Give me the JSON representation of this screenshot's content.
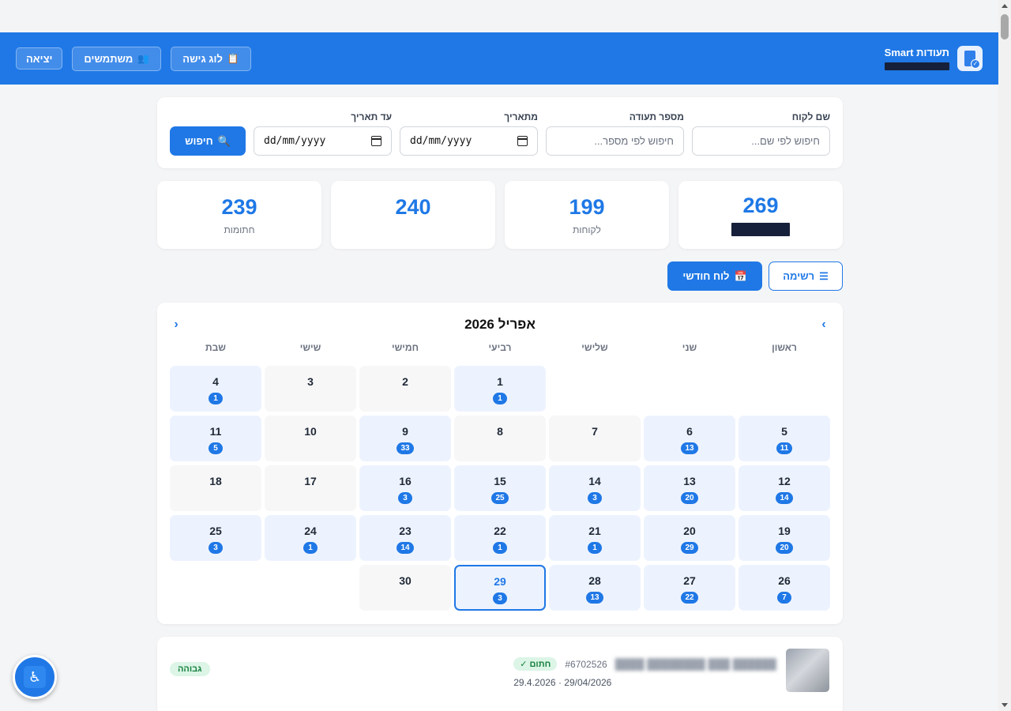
{
  "header": {
    "brand_title": "תעודות Smart",
    "buttons": {
      "access_log": "לוג גישה",
      "users": "משתמשים",
      "logout": "יציאה"
    },
    "icons": {
      "access_log": "clipboard-icon",
      "users": "users-icon"
    }
  },
  "search": {
    "customer_label": "שם לקוח",
    "customer_placeholder": "חיפוש לפי שם...",
    "doc_label": "מספר תעודה",
    "doc_placeholder": "חיפוש לפי מספר...",
    "from_label": "מתאריך",
    "from_value": "dd/mm/yyyy",
    "to_label": "עד תאריך",
    "to_value": "dd/mm/yyyy",
    "search_button": "חיפוש"
  },
  "stats": [
    {
      "value": "269",
      "label": ""
    },
    {
      "value": "199",
      "label": "לקוחות"
    },
    {
      "value": "240",
      "label": ""
    },
    {
      "value": "239",
      "label": "חתומות"
    }
  ],
  "view": {
    "list": "רשימה",
    "month": "לוח חודשי"
  },
  "calendar": {
    "title": "אפריל 2026",
    "weekdays": [
      "ראשון",
      "שני",
      "שלישי",
      "רביעי",
      "חמישי",
      "שישי",
      "שבת"
    ],
    "today": 29,
    "weeks": [
      [
        null,
        null,
        null,
        {
          "d": 1,
          "c": 1
        },
        {
          "d": 2,
          "c": 0
        },
        {
          "d": 3,
          "c": 0
        },
        {
          "d": 4,
          "c": 1
        }
      ],
      [
        {
          "d": 5,
          "c": 11
        },
        {
          "d": 6,
          "c": 13
        },
        {
          "d": 7,
          "c": 0
        },
        {
          "d": 8,
          "c": 0
        },
        {
          "d": 9,
          "c": 33
        },
        {
          "d": 10,
          "c": 0
        },
        {
          "d": 11,
          "c": 5
        }
      ],
      [
        {
          "d": 12,
          "c": 14
        },
        {
          "d": 13,
          "c": 20
        },
        {
          "d": 14,
          "c": 3
        },
        {
          "d": 15,
          "c": 25
        },
        {
          "d": 16,
          "c": 3
        },
        {
          "d": 17,
          "c": 0
        },
        {
          "d": 18,
          "c": 0
        }
      ],
      [
        {
          "d": 19,
          "c": 20
        },
        {
          "d": 20,
          "c": 29
        },
        {
          "d": 21,
          "c": 1
        },
        {
          "d": 22,
          "c": 1
        },
        {
          "d": 23,
          "c": 14
        },
        {
          "d": 24,
          "c": 1
        },
        {
          "d": 25,
          "c": 3
        }
      ],
      [
        {
          "d": 26,
          "c": 7
        },
        {
          "d": 27,
          "c": 22
        },
        {
          "d": 28,
          "c": 13
        },
        {
          "d": 29,
          "c": 3
        },
        {
          "d": 30,
          "c": 0
        },
        null,
        null
      ]
    ]
  },
  "list_row": {
    "id": "#6702526",
    "status": "חתום ✓",
    "date": "29/04/2026 · 29.4.2026",
    "priority": "גבוהה"
  },
  "colors": {
    "primary": "#1f78e6",
    "signed_bg": "#dcf5e6",
    "signed_text": "#15803d"
  }
}
